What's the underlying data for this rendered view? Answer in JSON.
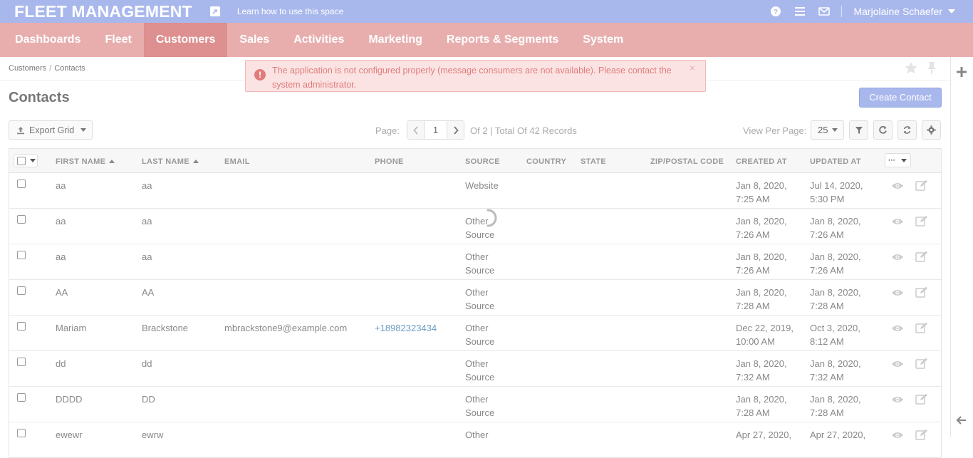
{
  "topbar": {
    "app_title": "FLEET MANAGEMENT",
    "help_link": "Learn how to use this space",
    "user_name": "Marjolaine Schaefer"
  },
  "nav": {
    "items": [
      "Dashboards",
      "Fleet",
      "Customers",
      "Sales",
      "Activities",
      "Marketing",
      "Reports & Segments",
      "System"
    ],
    "active": "Customers"
  },
  "breadcrumb": {
    "parent": "Customers",
    "current": "Contacts"
  },
  "alert": {
    "message": "The application is not configured properly (message consumers are not available). Please contact the system administrator.",
    "close": "×"
  },
  "page": {
    "title": "Contacts",
    "create_label": "Create Contact"
  },
  "toolbar": {
    "export_label": "Export Grid",
    "page_label": "Page:",
    "page_value": "1",
    "page_info": "Of 2 |  Total Of 42 Records",
    "per_page_label": "View Per Page:",
    "per_page_value": "25"
  },
  "grid": {
    "columns": [
      "FIRST NAME",
      "LAST NAME",
      "EMAIL",
      "PHONE",
      "SOURCE",
      "COUNTRY",
      "STATE",
      "ZIP/POSTAL CODE",
      "CREATED AT",
      "UPDATED AT"
    ],
    "actions_label": "···",
    "rows": [
      {
        "first": "aa",
        "last": "aa",
        "email": "",
        "phone": "",
        "source": "Website",
        "country": "",
        "state": "",
        "zip": "",
        "created": "Jan 8, 2020, 7:25 AM",
        "updated": "Jul 14, 2020, 5:30 PM"
      },
      {
        "first": "aa",
        "last": "aa",
        "email": "",
        "phone": "",
        "source": "Other Source",
        "country": "",
        "state": "",
        "zip": "",
        "created": "Jan 8, 2020, 7:26 AM",
        "updated": "Jan 8, 2020, 7:26 AM"
      },
      {
        "first": "aa",
        "last": "aa",
        "email": "",
        "phone": "",
        "source": "Other Source",
        "country": "",
        "state": "",
        "zip": "",
        "created": "Jan 8, 2020, 7:26 AM",
        "updated": "Jan 8, 2020, 7:26 AM"
      },
      {
        "first": "AA",
        "last": "AA",
        "email": "",
        "phone": "",
        "source": "Other Source",
        "country": "",
        "state": "",
        "zip": "",
        "created": "Jan 8, 2020, 7:28 AM",
        "updated": "Jan 8, 2020, 7:28 AM"
      },
      {
        "first": "Mariam",
        "last": "Brackstone",
        "email": "mbrackstone9@example.com",
        "phone": "+18982323434",
        "source": "Other Source",
        "country": "",
        "state": "",
        "zip": "",
        "created": "Dec 22, 2019, 10:00 AM",
        "updated": "Oct 3, 2020, 8:12 AM"
      },
      {
        "first": "dd",
        "last": "dd",
        "email": "",
        "phone": "",
        "source": "Other Source",
        "country": "",
        "state": "",
        "zip": "",
        "created": "Jan 8, 2020, 7:32 AM",
        "updated": "Jan 8, 2020, 7:32 AM"
      },
      {
        "first": "DDDD",
        "last": "DD",
        "email": "",
        "phone": "",
        "source": "Other Source",
        "country": "",
        "state": "",
        "zip": "",
        "created": "Jan 8, 2020, 7:28 AM",
        "updated": "Jan 8, 2020, 7:28 AM"
      },
      {
        "first": "ewewr",
        "last": "ewrw",
        "email": "",
        "phone": "",
        "source": "Other",
        "country": "",
        "state": "",
        "zip": "",
        "created": "Apr 27, 2020,",
        "updated": "Apr 27, 2020,"
      }
    ]
  },
  "colors": {
    "topbar": "#a9b8ec",
    "nav": "#e8aeae",
    "nav_active": "#de8f8f",
    "alert_bg": "#fbe3e3",
    "alert_text": "#e07d7d",
    "link": "#6b9cc4"
  },
  "icons": [
    "external-link-icon",
    "help-icon",
    "menu-icon",
    "mail-icon",
    "star-icon",
    "pin-icon",
    "plus-icon",
    "back-arrow-icon",
    "upload-icon",
    "filter-icon",
    "refresh-icon",
    "reset-icon",
    "gear-icon",
    "eye-icon",
    "edit-icon",
    "loading-spinner"
  ]
}
